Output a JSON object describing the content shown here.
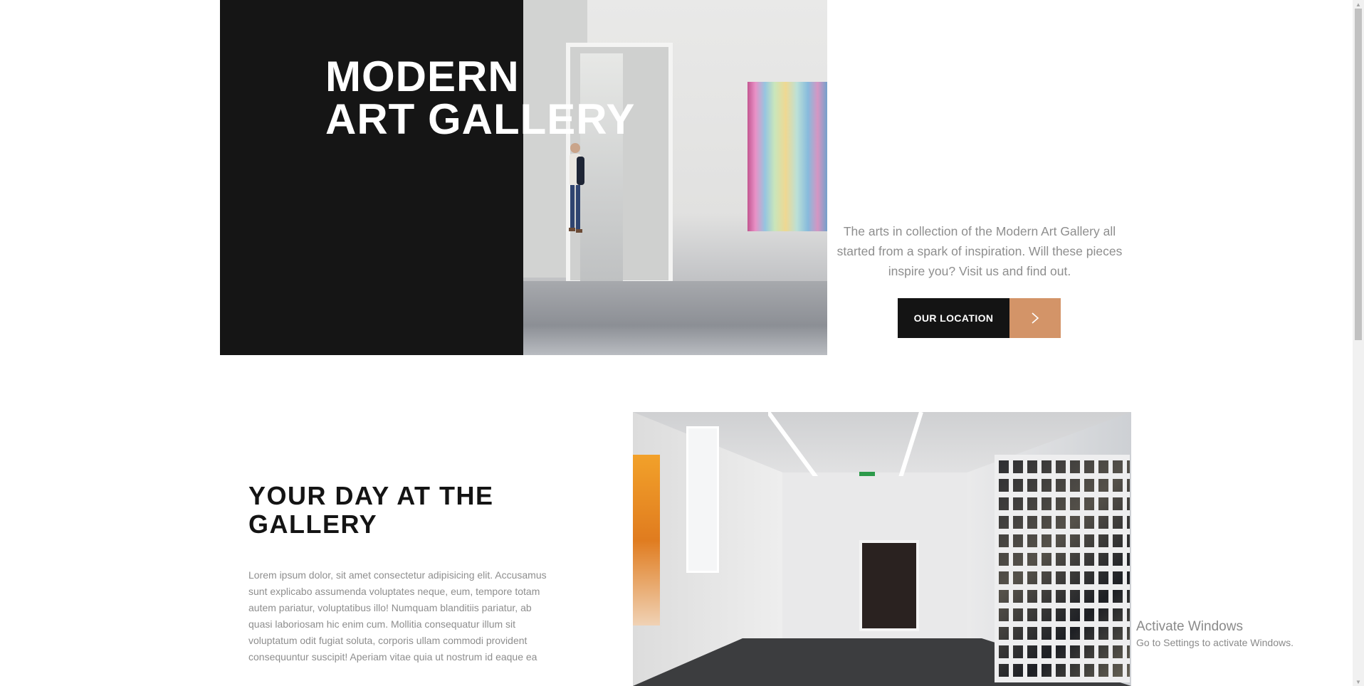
{
  "hero": {
    "title_line1": "MODERN",
    "title_line2": "ART GALLERY",
    "description": "The arts in collection of the Modern Art Gallery all started from a spark of inspiration. Will these pieces inspire you? Visit us and find out.",
    "cta_label": "OUR LOCATION",
    "cta_icon": "chevron-right-icon"
  },
  "day_section": {
    "title_line1": "YOUR DAY AT THE",
    "title_line2": "GALLERY",
    "body": "Lorem ipsum dolor, sit amet consectetur adipisicing elit. Accusamus sunt explicabo assumenda voluptates neque, eum, tempore totam autem pariatur, voluptatibus illo! Numquam blanditiis pariatur, ab quasi laboriosam hic enim cum. Mollitia consequatur illum sit voluptatum odit fugiat soluta, corporis ullam commodi provident consequuntur suscipit! Aperiam vitae quia ut nostrum id eaque ea"
  },
  "os_overlay": {
    "activate_title": "Activate Windows",
    "activate_subtitle": "Go to Settings to activate Windows."
  },
  "colors": {
    "dark": "#151515",
    "accent": "#d39468",
    "muted_text": "#8e8e8e"
  }
}
